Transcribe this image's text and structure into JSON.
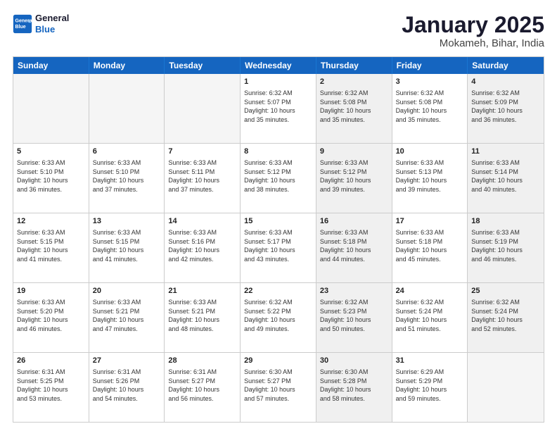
{
  "logo": {
    "line1": "General",
    "line2": "Blue"
  },
  "title": "January 2025",
  "location": "Mokameh, Bihar, India",
  "weekdays": [
    "Sunday",
    "Monday",
    "Tuesday",
    "Wednesday",
    "Thursday",
    "Friday",
    "Saturday"
  ],
  "rows": [
    [
      {
        "day": "",
        "info": "",
        "shaded": false,
        "empty": true
      },
      {
        "day": "",
        "info": "",
        "shaded": false,
        "empty": true
      },
      {
        "day": "",
        "info": "",
        "shaded": false,
        "empty": true
      },
      {
        "day": "1",
        "info": "Sunrise: 6:32 AM\nSunset: 5:07 PM\nDaylight: 10 hours\nand 35 minutes.",
        "shaded": false,
        "empty": false
      },
      {
        "day": "2",
        "info": "Sunrise: 6:32 AM\nSunset: 5:08 PM\nDaylight: 10 hours\nand 35 minutes.",
        "shaded": true,
        "empty": false
      },
      {
        "day": "3",
        "info": "Sunrise: 6:32 AM\nSunset: 5:08 PM\nDaylight: 10 hours\nand 35 minutes.",
        "shaded": false,
        "empty": false
      },
      {
        "day": "4",
        "info": "Sunrise: 6:32 AM\nSunset: 5:09 PM\nDaylight: 10 hours\nand 36 minutes.",
        "shaded": true,
        "empty": false
      }
    ],
    [
      {
        "day": "5",
        "info": "Sunrise: 6:33 AM\nSunset: 5:10 PM\nDaylight: 10 hours\nand 36 minutes.",
        "shaded": false,
        "empty": false
      },
      {
        "day": "6",
        "info": "Sunrise: 6:33 AM\nSunset: 5:10 PM\nDaylight: 10 hours\nand 37 minutes.",
        "shaded": false,
        "empty": false
      },
      {
        "day": "7",
        "info": "Sunrise: 6:33 AM\nSunset: 5:11 PM\nDaylight: 10 hours\nand 37 minutes.",
        "shaded": false,
        "empty": false
      },
      {
        "day": "8",
        "info": "Sunrise: 6:33 AM\nSunset: 5:12 PM\nDaylight: 10 hours\nand 38 minutes.",
        "shaded": false,
        "empty": false
      },
      {
        "day": "9",
        "info": "Sunrise: 6:33 AM\nSunset: 5:12 PM\nDaylight: 10 hours\nand 39 minutes.",
        "shaded": true,
        "empty": false
      },
      {
        "day": "10",
        "info": "Sunrise: 6:33 AM\nSunset: 5:13 PM\nDaylight: 10 hours\nand 39 minutes.",
        "shaded": false,
        "empty": false
      },
      {
        "day": "11",
        "info": "Sunrise: 6:33 AM\nSunset: 5:14 PM\nDaylight: 10 hours\nand 40 minutes.",
        "shaded": true,
        "empty": false
      }
    ],
    [
      {
        "day": "12",
        "info": "Sunrise: 6:33 AM\nSunset: 5:15 PM\nDaylight: 10 hours\nand 41 minutes.",
        "shaded": false,
        "empty": false
      },
      {
        "day": "13",
        "info": "Sunrise: 6:33 AM\nSunset: 5:15 PM\nDaylight: 10 hours\nand 41 minutes.",
        "shaded": false,
        "empty": false
      },
      {
        "day": "14",
        "info": "Sunrise: 6:33 AM\nSunset: 5:16 PM\nDaylight: 10 hours\nand 42 minutes.",
        "shaded": false,
        "empty": false
      },
      {
        "day": "15",
        "info": "Sunrise: 6:33 AM\nSunset: 5:17 PM\nDaylight: 10 hours\nand 43 minutes.",
        "shaded": false,
        "empty": false
      },
      {
        "day": "16",
        "info": "Sunrise: 6:33 AM\nSunset: 5:18 PM\nDaylight: 10 hours\nand 44 minutes.",
        "shaded": true,
        "empty": false
      },
      {
        "day": "17",
        "info": "Sunrise: 6:33 AM\nSunset: 5:18 PM\nDaylight: 10 hours\nand 45 minutes.",
        "shaded": false,
        "empty": false
      },
      {
        "day": "18",
        "info": "Sunrise: 6:33 AM\nSunset: 5:19 PM\nDaylight: 10 hours\nand 46 minutes.",
        "shaded": true,
        "empty": false
      }
    ],
    [
      {
        "day": "19",
        "info": "Sunrise: 6:33 AM\nSunset: 5:20 PM\nDaylight: 10 hours\nand 46 minutes.",
        "shaded": false,
        "empty": false
      },
      {
        "day": "20",
        "info": "Sunrise: 6:33 AM\nSunset: 5:21 PM\nDaylight: 10 hours\nand 47 minutes.",
        "shaded": false,
        "empty": false
      },
      {
        "day": "21",
        "info": "Sunrise: 6:33 AM\nSunset: 5:21 PM\nDaylight: 10 hours\nand 48 minutes.",
        "shaded": false,
        "empty": false
      },
      {
        "day": "22",
        "info": "Sunrise: 6:32 AM\nSunset: 5:22 PM\nDaylight: 10 hours\nand 49 minutes.",
        "shaded": false,
        "empty": false
      },
      {
        "day": "23",
        "info": "Sunrise: 6:32 AM\nSunset: 5:23 PM\nDaylight: 10 hours\nand 50 minutes.",
        "shaded": true,
        "empty": false
      },
      {
        "day": "24",
        "info": "Sunrise: 6:32 AM\nSunset: 5:24 PM\nDaylight: 10 hours\nand 51 minutes.",
        "shaded": false,
        "empty": false
      },
      {
        "day": "25",
        "info": "Sunrise: 6:32 AM\nSunset: 5:24 PM\nDaylight: 10 hours\nand 52 minutes.",
        "shaded": true,
        "empty": false
      }
    ],
    [
      {
        "day": "26",
        "info": "Sunrise: 6:31 AM\nSunset: 5:25 PM\nDaylight: 10 hours\nand 53 minutes.",
        "shaded": false,
        "empty": false
      },
      {
        "day": "27",
        "info": "Sunrise: 6:31 AM\nSunset: 5:26 PM\nDaylight: 10 hours\nand 54 minutes.",
        "shaded": false,
        "empty": false
      },
      {
        "day": "28",
        "info": "Sunrise: 6:31 AM\nSunset: 5:27 PM\nDaylight: 10 hours\nand 56 minutes.",
        "shaded": false,
        "empty": false
      },
      {
        "day": "29",
        "info": "Sunrise: 6:30 AM\nSunset: 5:27 PM\nDaylight: 10 hours\nand 57 minutes.",
        "shaded": false,
        "empty": false
      },
      {
        "day": "30",
        "info": "Sunrise: 6:30 AM\nSunset: 5:28 PM\nDaylight: 10 hours\nand 58 minutes.",
        "shaded": true,
        "empty": false
      },
      {
        "day": "31",
        "info": "Sunrise: 6:29 AM\nSunset: 5:29 PM\nDaylight: 10 hours\nand 59 minutes.",
        "shaded": false,
        "empty": false
      },
      {
        "day": "",
        "info": "",
        "shaded": true,
        "empty": true
      }
    ]
  ]
}
